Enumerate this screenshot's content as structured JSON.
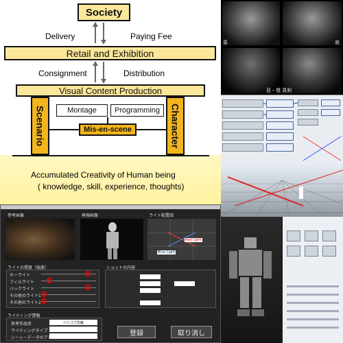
{
  "diagram": {
    "society": "Society",
    "delivery": "Delivery",
    "paying_fee": "Paying Fee",
    "retail": "Retail and Exhibition",
    "consignment": "Consignment",
    "distribution": "Distribution",
    "visual_content": "Visual Content Production",
    "montage": "Montage",
    "programming": "Programming",
    "mis_en_scene": "Mis-en-scene",
    "scenario": "Scenario",
    "character": "Character",
    "accumulated_line1": "Accumulated Creativity of Human being",
    "accumulated_line2": "( knowledge, skill, experience, thoughts)"
  },
  "faces": {
    "top_left": "喜",
    "top_right": "哀",
    "bottom_caption": "悲・憤 真剣"
  },
  "lighting_app": {
    "ref_image_label": "参考画像",
    "actual_image_label": "再現画像",
    "light_layout_label": "ライト配置図",
    "red_light": "Red Light",
    "blue_light": "Blue Light",
    "brightness_label": "ライトの照度（強度）",
    "shot_label": "ショットの内容",
    "lights": [
      "キーライト",
      "フィルライト",
      "バックライト",
      "その他のライト1",
      "その他のライト2"
    ],
    "info_label": "ライティング情報",
    "info_rows": [
      "参考作品名",
      "ライティングタイプ",
      "シーン・データのアドレス"
    ],
    "info_value": "ヘリコプ文献",
    "register_button": "登録",
    "cancel_button": "取り消し"
  }
}
